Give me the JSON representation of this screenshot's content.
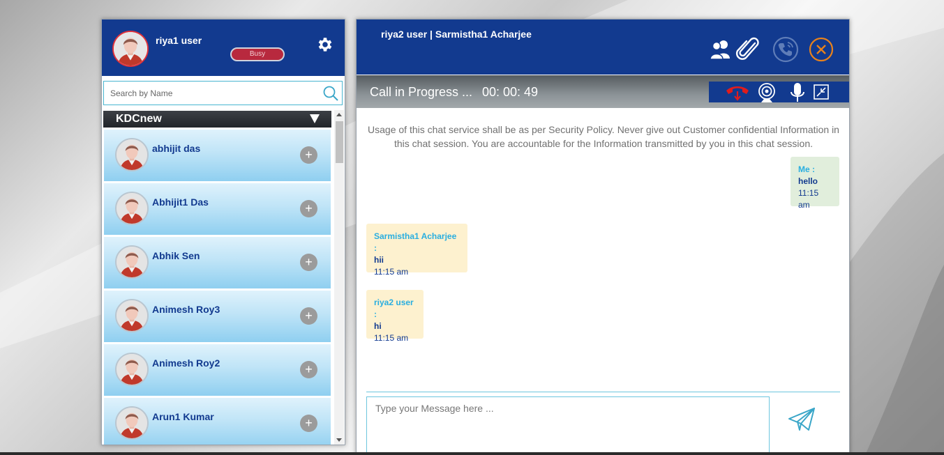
{
  "colors": {
    "header_blue": "#123a8f",
    "busy_red": "#b8293e",
    "sender_cyan": "#29aee0",
    "contact_gradient_top": "#dff2fc",
    "contact_gradient_bottom": "#8fcff0",
    "close_orange": "#e8821b",
    "hangup_red": "#e01c1c"
  },
  "current_user": {
    "name": "riya1 user",
    "status": "Busy",
    "avatar_icon": "user-avatar-icon",
    "settings_icon": "gear-icon"
  },
  "search": {
    "placeholder": "Search by Name",
    "icon": "search-icon"
  },
  "group": {
    "name": "KDCnew",
    "toggle_icon": "triangle-down-icon"
  },
  "contacts": [
    {
      "name": "abhijit das"
    },
    {
      "name": "Abhijit1 Das"
    },
    {
      "name": "Abhik Sen"
    },
    {
      "name": "Animesh Roy3"
    },
    {
      "name": "Animesh Roy2"
    },
    {
      "name": "Arun1 Kumar"
    }
  ],
  "chat": {
    "title": "riya2 user | Sarmistha1 Acharjee",
    "header_icons": [
      "users-icon",
      "paperclip-icon",
      "phone-call-icon",
      "close-icon"
    ],
    "call_status": "Call in Progress ...",
    "call_timer": "00: 00: 49",
    "call_controls": [
      "hangup-icon",
      "webcam-icon",
      "microphone-icon",
      "minimize-icon"
    ],
    "disclaimer": "Usage of this chat service shall be as per Security Policy. Never give out Customer confidential Information in this chat session. You are accountable for the Information transmitted by you in this chat session.",
    "messages": [
      {
        "sender": "Me :",
        "text": "hello",
        "time": "11:15 am",
        "side": "right"
      },
      {
        "sender": "Sarmistha1 Acharjee :",
        "text": "hii",
        "time": "11:15 am",
        "side": "left"
      },
      {
        "sender": "riya2 user :",
        "text": "hi",
        "time": "11:15 am",
        "side": "left"
      }
    ],
    "input_placeholder": "Type your Message here ...",
    "send_icon": "send-icon"
  }
}
